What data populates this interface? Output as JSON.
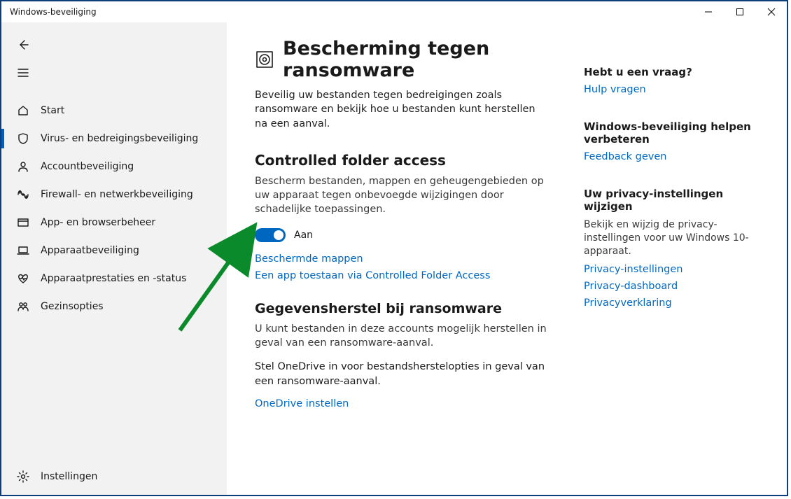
{
  "window": {
    "title": "Windows-beveiliging"
  },
  "sidebar": {
    "items": [
      {
        "label": "Start"
      },
      {
        "label": "Virus- en bedreigingsbeveiliging"
      },
      {
        "label": "Accountbeveiliging"
      },
      {
        "label": "Firewall- en netwerkbeveiliging"
      },
      {
        "label": "App- en browserbeheer"
      },
      {
        "label": "Apparaatbeveiliging"
      },
      {
        "label": "Apparaatprestaties en -status"
      },
      {
        "label": "Gezinsopties"
      }
    ],
    "settings_label": "Instellingen"
  },
  "main": {
    "title": "Bescherming tegen ransomware",
    "description": "Beveilig uw bestanden tegen bedreigingen zoals ransomware en bekijk hoe u bestanden kunt herstellen na een aanval.",
    "cfa": {
      "title": "Controlled folder access",
      "description": "Bescherm bestanden, mappen en geheugengebieden op uw apparaat tegen onbevoegde wijzigingen door schadelijke toepassingen.",
      "toggle_state": "Aan",
      "link_protected": "Beschermde mappen",
      "link_allow": "Een app toestaan via Controlled Folder Access"
    },
    "recovery": {
      "title": "Gegevensherstel bij ransomware",
      "description": "U kunt bestanden in deze accounts mogelijk herstellen in geval van een ransomware-aanval.",
      "onedrive_text": "Stel OneDrive in voor bestandsherstelopties in geval van een ransomware-aanval.",
      "onedrive_link": "OneDrive instellen"
    }
  },
  "aside": {
    "question": {
      "title": "Hebt u een vraag?",
      "link": "Hulp vragen"
    },
    "improve": {
      "title": "Windows-beveiliging helpen verbeteren",
      "link": "Feedback geven"
    },
    "privacy": {
      "title": "Uw privacy-instellingen wijzigen",
      "description": "Bekijk en wijzig de privacy-instellingen voor uw Windows 10-apparaat.",
      "link1": "Privacy-instellingen",
      "link2": "Privacy-dashboard",
      "link3": "Privacyverklaring"
    }
  }
}
